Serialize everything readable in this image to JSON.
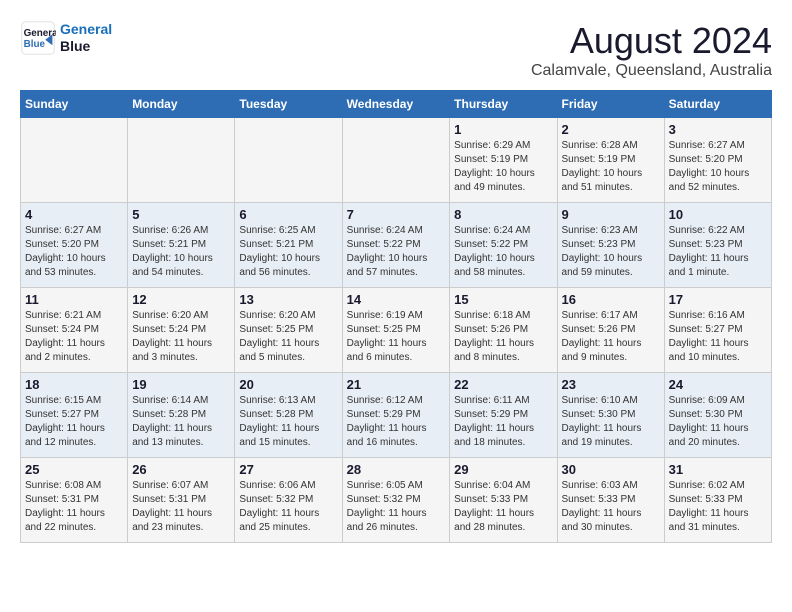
{
  "header": {
    "logo_line1": "General",
    "logo_line2": "Blue",
    "month_year": "August 2024",
    "location": "Calamvale, Queensland, Australia"
  },
  "weekdays": [
    "Sunday",
    "Monday",
    "Tuesday",
    "Wednesday",
    "Thursday",
    "Friday",
    "Saturday"
  ],
  "weeks": [
    [
      {
        "day": "",
        "info": ""
      },
      {
        "day": "",
        "info": ""
      },
      {
        "day": "",
        "info": ""
      },
      {
        "day": "",
        "info": ""
      },
      {
        "day": "1",
        "info": "Sunrise: 6:29 AM\nSunset: 5:19 PM\nDaylight: 10 hours\nand 49 minutes."
      },
      {
        "day": "2",
        "info": "Sunrise: 6:28 AM\nSunset: 5:19 PM\nDaylight: 10 hours\nand 51 minutes."
      },
      {
        "day": "3",
        "info": "Sunrise: 6:27 AM\nSunset: 5:20 PM\nDaylight: 10 hours\nand 52 minutes."
      }
    ],
    [
      {
        "day": "4",
        "info": "Sunrise: 6:27 AM\nSunset: 5:20 PM\nDaylight: 10 hours\nand 53 minutes."
      },
      {
        "day": "5",
        "info": "Sunrise: 6:26 AM\nSunset: 5:21 PM\nDaylight: 10 hours\nand 54 minutes."
      },
      {
        "day": "6",
        "info": "Sunrise: 6:25 AM\nSunset: 5:21 PM\nDaylight: 10 hours\nand 56 minutes."
      },
      {
        "day": "7",
        "info": "Sunrise: 6:24 AM\nSunset: 5:22 PM\nDaylight: 10 hours\nand 57 minutes."
      },
      {
        "day": "8",
        "info": "Sunrise: 6:24 AM\nSunset: 5:22 PM\nDaylight: 10 hours\nand 58 minutes."
      },
      {
        "day": "9",
        "info": "Sunrise: 6:23 AM\nSunset: 5:23 PM\nDaylight: 10 hours\nand 59 minutes."
      },
      {
        "day": "10",
        "info": "Sunrise: 6:22 AM\nSunset: 5:23 PM\nDaylight: 11 hours\nand 1 minute."
      }
    ],
    [
      {
        "day": "11",
        "info": "Sunrise: 6:21 AM\nSunset: 5:24 PM\nDaylight: 11 hours\nand 2 minutes."
      },
      {
        "day": "12",
        "info": "Sunrise: 6:20 AM\nSunset: 5:24 PM\nDaylight: 11 hours\nand 3 minutes."
      },
      {
        "day": "13",
        "info": "Sunrise: 6:20 AM\nSunset: 5:25 PM\nDaylight: 11 hours\nand 5 minutes."
      },
      {
        "day": "14",
        "info": "Sunrise: 6:19 AM\nSunset: 5:25 PM\nDaylight: 11 hours\nand 6 minutes."
      },
      {
        "day": "15",
        "info": "Sunrise: 6:18 AM\nSunset: 5:26 PM\nDaylight: 11 hours\nand 8 minutes."
      },
      {
        "day": "16",
        "info": "Sunrise: 6:17 AM\nSunset: 5:26 PM\nDaylight: 11 hours\nand 9 minutes."
      },
      {
        "day": "17",
        "info": "Sunrise: 6:16 AM\nSunset: 5:27 PM\nDaylight: 11 hours\nand 10 minutes."
      }
    ],
    [
      {
        "day": "18",
        "info": "Sunrise: 6:15 AM\nSunset: 5:27 PM\nDaylight: 11 hours\nand 12 minutes."
      },
      {
        "day": "19",
        "info": "Sunrise: 6:14 AM\nSunset: 5:28 PM\nDaylight: 11 hours\nand 13 minutes."
      },
      {
        "day": "20",
        "info": "Sunrise: 6:13 AM\nSunset: 5:28 PM\nDaylight: 11 hours\nand 15 minutes."
      },
      {
        "day": "21",
        "info": "Sunrise: 6:12 AM\nSunset: 5:29 PM\nDaylight: 11 hours\nand 16 minutes."
      },
      {
        "day": "22",
        "info": "Sunrise: 6:11 AM\nSunset: 5:29 PM\nDaylight: 11 hours\nand 18 minutes."
      },
      {
        "day": "23",
        "info": "Sunrise: 6:10 AM\nSunset: 5:30 PM\nDaylight: 11 hours\nand 19 minutes."
      },
      {
        "day": "24",
        "info": "Sunrise: 6:09 AM\nSunset: 5:30 PM\nDaylight: 11 hours\nand 20 minutes."
      }
    ],
    [
      {
        "day": "25",
        "info": "Sunrise: 6:08 AM\nSunset: 5:31 PM\nDaylight: 11 hours\nand 22 minutes."
      },
      {
        "day": "26",
        "info": "Sunrise: 6:07 AM\nSunset: 5:31 PM\nDaylight: 11 hours\nand 23 minutes."
      },
      {
        "day": "27",
        "info": "Sunrise: 6:06 AM\nSunset: 5:32 PM\nDaylight: 11 hours\nand 25 minutes."
      },
      {
        "day": "28",
        "info": "Sunrise: 6:05 AM\nSunset: 5:32 PM\nDaylight: 11 hours\nand 26 minutes."
      },
      {
        "day": "29",
        "info": "Sunrise: 6:04 AM\nSunset: 5:33 PM\nDaylight: 11 hours\nand 28 minutes."
      },
      {
        "day": "30",
        "info": "Sunrise: 6:03 AM\nSunset: 5:33 PM\nDaylight: 11 hours\nand 30 minutes."
      },
      {
        "day": "31",
        "info": "Sunrise: 6:02 AM\nSunset: 5:33 PM\nDaylight: 11 hours\nand 31 minutes."
      }
    ]
  ]
}
